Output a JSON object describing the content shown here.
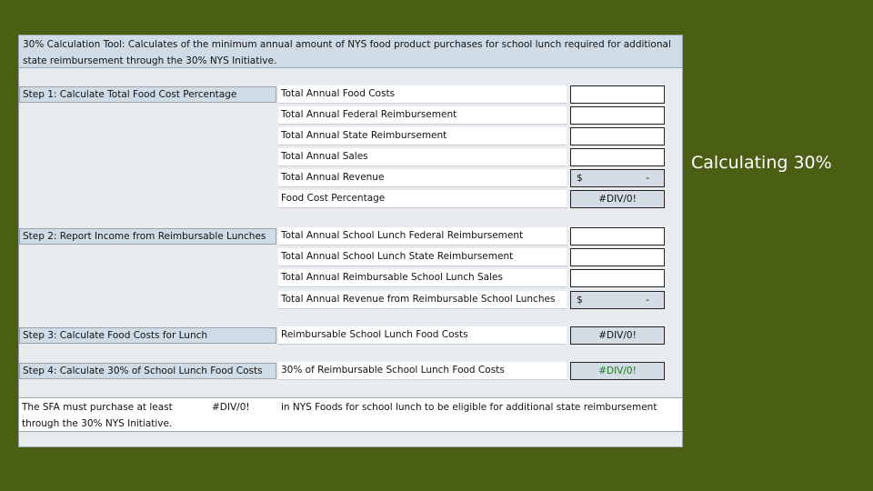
{
  "side_title": "Calculating 30%",
  "header": {
    "line1": "30% Calculation Tool: Calculates of the minimum annual amount of NYS food product purchases for school lunch required for additional",
    "line2": "state reimbursement through the 30% NYS Initiative."
  },
  "steps": {
    "s1": "Step 1: Calculate Total Food Cost Percentage",
    "s2": "Step 2: Report Income from Reimbursable Lunches",
    "s3": "Step 3: Calculate Food Costs for Lunch",
    "s4": "Step 4: Calculate 30% of School Lunch Food Costs"
  },
  "rows": {
    "r1": "Total Annual Food Costs",
    "r2": "Total Annual Federal Reimbursement",
    "r3": "Total Annual State Reimbursement",
    "r4": "Total Annual Sales",
    "r5": "Total Annual Revenue",
    "r6": "Food Cost Percentage",
    "r7": "Total Annual School Lunch Federal Reimbursement",
    "r8": "Total Annual School Lunch State Reimbursement",
    "r9": "Total Annual Reimbursable School Lunch Sales",
    "r10": "Total Annual Revenue from Reimbursable School Lunches",
    "r11": "Reimbursable School Lunch Food Costs",
    "r12": "30% of Reimbursable School Lunch Food Costs"
  },
  "values": {
    "currency": "$",
    "dash": "-",
    "div0": "#DIV/0!"
  },
  "footer": {
    "left": "The SFA must purchase at least through the 30% NYS Initiative.",
    "result": "#DIV/0!",
    "right": "in NYS Foods for school lunch to be eligible for additional state reimbursement"
  },
  "colors": {
    "background": "#4a5e14",
    "header_fill": "#cfdce6",
    "calc_fill": "#d4dde6",
    "result_green": "#1f7a1f"
  }
}
